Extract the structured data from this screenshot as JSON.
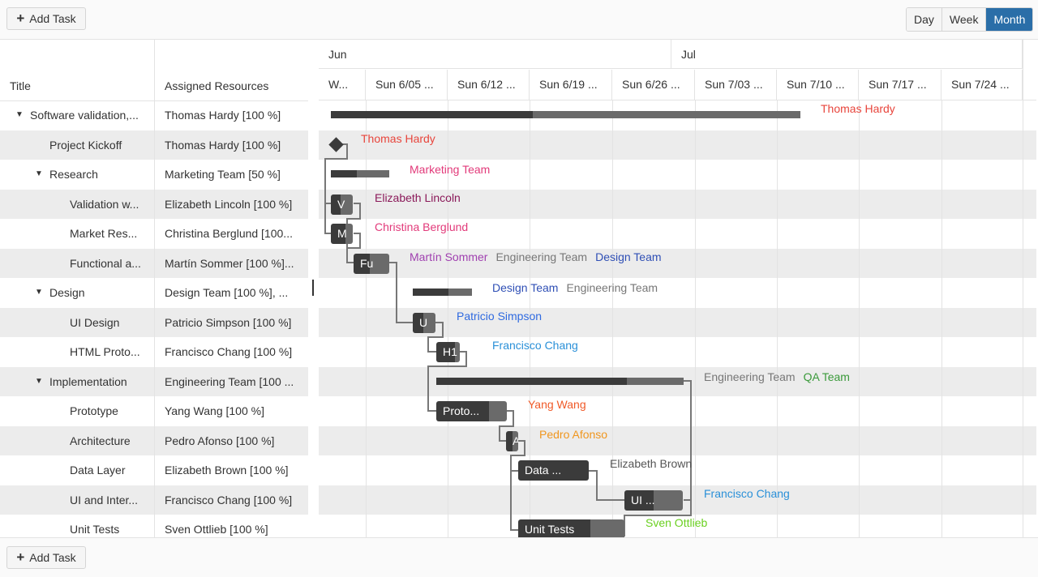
{
  "toolbar": {
    "add_task": "Add Task",
    "views": [
      "Day",
      "Week",
      "Month"
    ],
    "active_view": "Month"
  },
  "columns": {
    "title": "Title",
    "resources": "Assigned Resources"
  },
  "timeline": {
    "months": [
      "Jun",
      "Jul"
    ],
    "weeks": [
      "W...",
      "Sun 6/05 ...",
      "Sun 6/12 ...",
      "Sun 6/19 ...",
      "Sun 6/26 ...",
      "Sun 7/03 ...",
      "Sun 7/10 ...",
      "Sun 7/17 ...",
      "Sun 7/24 ..."
    ]
  },
  "tasks": [
    {
      "title": "Software validation,...",
      "resources": "Thomas Hardy [100 %]",
      "level": 0,
      "summary": true,
      "expanded": true
    },
    {
      "title": "Project Kickoff",
      "resources": "Thomas Hardy [100 %]",
      "level": 1
    },
    {
      "title": "Research",
      "resources": "Marketing Team [50 %]",
      "level": 1,
      "summary": true,
      "expanded": true
    },
    {
      "title": "Validation w...",
      "resources": "Elizabeth Lincoln [100 %]",
      "level": 2
    },
    {
      "title": "Market Res...",
      "resources": "Christina Berglund [100...",
      "level": 2
    },
    {
      "title": "Functional a...",
      "resources": "Martín Sommer [100 %]...",
      "level": 2
    },
    {
      "title": "Design",
      "resources": "Design Team [100 %], ...",
      "level": 1,
      "summary": true,
      "expanded": true
    },
    {
      "title": "UI Design",
      "resources": "Patricio Simpson [100 %]",
      "level": 2
    },
    {
      "title": "HTML Proto...",
      "resources": "Francisco Chang [100 %]",
      "level": 2
    },
    {
      "title": "Implementation",
      "resources": "Engineering Team [100 ...",
      "level": 1,
      "summary": true,
      "expanded": true
    },
    {
      "title": "Prototype",
      "resources": "Yang Wang [100 %]",
      "level": 2
    },
    {
      "title": "Architecture",
      "resources": "Pedro Afonso [100 %]",
      "level": 2
    },
    {
      "title": "Data Layer",
      "resources": "Elizabeth Brown [100 %]",
      "level": 2
    },
    {
      "title": "UI and Inter...",
      "resources": "Francisco Chang [100 %]",
      "level": 2
    },
    {
      "title": "Unit Tests",
      "resources": "Sven Ottlieb [100 %]",
      "level": 2
    }
  ],
  "gantt_bars": [
    {
      "label": "",
      "summary": true,
      "progress": 0.43
    },
    {
      "label": "",
      "milestone": true
    },
    {
      "label": "",
      "summary": true,
      "progress": 0.45
    },
    {
      "label": "V",
      "progress": 0.45
    },
    {
      "label": "M",
      "progress": 0.65
    },
    {
      "label": "Fu",
      "progress": 0.45
    },
    {
      "label": "",
      "summary": true,
      "progress": 0.6
    },
    {
      "label": "U",
      "progress": 0.45
    },
    {
      "label": "H1",
      "progress": 0.8
    },
    {
      "label": "",
      "summary": true,
      "progress": 0.77
    },
    {
      "label": "Proto...",
      "progress": 0.75
    },
    {
      "label": "A",
      "progress": 0.5
    },
    {
      "label": "Data ...",
      "progress": 1.0
    },
    {
      "label": "UI ...",
      "progress": 0.5
    },
    {
      "label": "Unit Tests",
      "progress": 0.68
    }
  ],
  "bar_resources": [
    [
      {
        "name": "Thomas Hardy",
        "color": "#e8453c"
      }
    ],
    [
      {
        "name": "Thomas Hardy",
        "color": "#e8453c"
      }
    ],
    [
      {
        "name": "Marketing Team",
        "color": "#e23a7a"
      }
    ],
    [
      {
        "name": "Elizabeth Lincoln",
        "color": "#8b1a5a"
      }
    ],
    [
      {
        "name": "Christina Berglund",
        "color": "#e23a7a"
      }
    ],
    [
      {
        "name": "Martín Sommer",
        "color": "#a040b0"
      },
      {
        "name": "Engineering Team",
        "color": "#777777"
      },
      {
        "name": "Design Team",
        "color": "#2f4fb5"
      }
    ],
    [
      {
        "name": "Design Team",
        "color": "#2f4fb5"
      },
      {
        "name": "Engineering Team",
        "color": "#777777"
      }
    ],
    [
      {
        "name": "Patricio Simpson",
        "color": "#2f6ae0"
      }
    ],
    [
      {
        "name": "Francisco Chang",
        "color": "#2a90d8"
      }
    ],
    [
      {
        "name": "Engineering Team",
        "color": "#777777"
      },
      {
        "name": "QA Team",
        "color": "#3a9a3a"
      }
    ],
    [
      {
        "name": "Yang Wang",
        "color": "#f05a28"
      }
    ],
    [
      {
        "name": "Pedro Afonso",
        "color": "#f0961e"
      }
    ],
    [
      {
        "name": "Elizabeth Brown",
        "color": "#555555"
      }
    ],
    [
      {
        "name": "Francisco Chang",
        "color": "#2a90d8"
      }
    ],
    [
      {
        "name": "Sven Ottlieb",
        "color": "#6ad020"
      }
    ]
  ],
  "footer": {
    "add_task": "Add Task"
  }
}
